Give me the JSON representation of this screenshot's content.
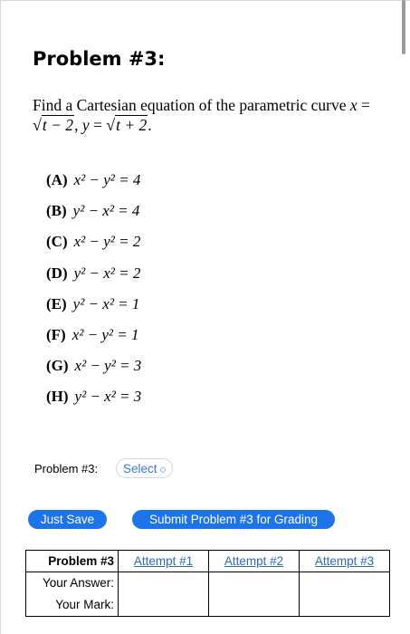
{
  "problem": {
    "title": "Problem #3:",
    "question_prefix": "Find a Cartesian equation of the parametric curve ",
    "var_x": "x",
    "eq1_lhs": "= ",
    "rad1": "t − 2",
    "sep": ", ",
    "var_y": "y",
    "eq2_lhs": " = ",
    "rad2": "t + 2",
    "period": "."
  },
  "choices": [
    {
      "label": "(A)",
      "eq": "x² − y² = 4"
    },
    {
      "label": "(B)",
      "eq": "y² − x² = 4"
    },
    {
      "label": "(C)",
      "eq": "x² − y² = 2"
    },
    {
      "label": "(D)",
      "eq": "y² − x² = 2"
    },
    {
      "label": "(E)",
      "eq": "y² − x² = 1"
    },
    {
      "label": "(F)",
      "eq": "x² − y² = 1"
    },
    {
      "label": "(G)",
      "eq": "x² − y² = 3"
    },
    {
      "label": "(H)",
      "eq": "y² − x² = 3"
    }
  ],
  "answer": {
    "label": "Problem #3:",
    "select_value": "Select",
    "select_icon": "up-down-chevron-icon"
  },
  "buttons": {
    "save": "Just Save",
    "submit": "Submit Problem #3 for Grading"
  },
  "attempts_table": {
    "header": "Problem #3",
    "attempts": [
      "Attempt #1",
      "Attempt #2",
      "Attempt #3"
    ],
    "row_labels": [
      "Your Answer:",
      "Your Mark:"
    ]
  },
  "colors": {
    "accent": "#1f73e8",
    "link": "#2a6bbf"
  }
}
